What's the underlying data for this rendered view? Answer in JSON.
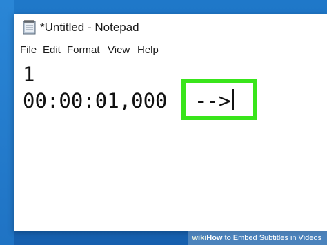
{
  "window": {
    "title": "*Untitled - Notepad"
  },
  "menubar": {
    "items": [
      {
        "label": "File"
      },
      {
        "label": "Edit"
      },
      {
        "label": "Format"
      },
      {
        "label": "View"
      },
      {
        "label": "Help"
      }
    ]
  },
  "editor": {
    "line1": "1",
    "line2": "00:00:01,000",
    "highlighted_text": "-->"
  },
  "watermark": {
    "brand_wiki": "wiki",
    "brand_how": "How",
    "text": " to Embed Subtitles in Videos"
  },
  "colors": {
    "highlight_border": "#39e51b",
    "desktop_blue": "#1f78c9"
  },
  "icons": {
    "app_icon": "notepad-icon"
  }
}
